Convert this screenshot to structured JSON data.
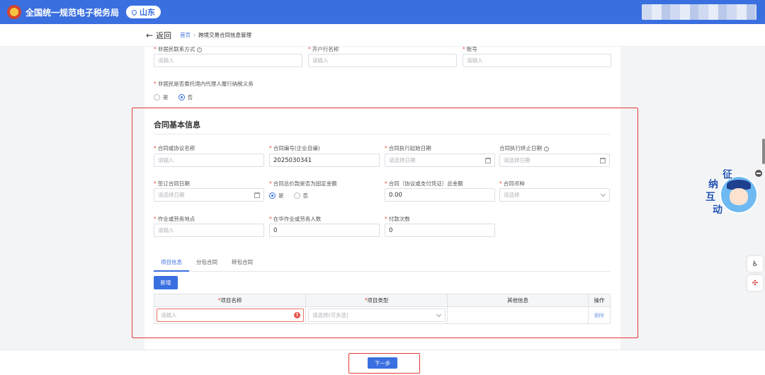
{
  "header": {
    "app_title": "全国统一规范电子税务局",
    "region": "山东"
  },
  "nav": {
    "back_label": "返回",
    "crumb_home": "首页",
    "crumb_sep": "›",
    "crumb_current": "跨境交易合同信息管理"
  },
  "top_fields": {
    "contact_label": "非居民联系方式",
    "bank_label": "开户行名称",
    "account_label": "账号",
    "placeholder": "请输入",
    "agent_question": "非居民是否委托境内代理人履行纳税义务",
    "yes": "是",
    "no": "否"
  },
  "contract": {
    "section_title": "合同基本信息",
    "name_label": "合同或协议名称",
    "name_placeholder": "请输入",
    "number_label": "合同编号(企业自编)",
    "number_value": "2025030341",
    "start_label": "合同执行起始日期",
    "end_label": "合同执行终止日期",
    "date_placeholder": "请选择日期",
    "sign_label": "签订合同日期",
    "fixed_label": "合同总价款是否为固定金额",
    "yes": "是",
    "no": "否",
    "total_label": "合同（协议或支付凭证）总金额",
    "total_value": "0.00",
    "currency_label": "合同币种",
    "select_placeholder": "请选择",
    "location_label": "作业或劳务地点",
    "location_placeholder": "请输入",
    "workers_label": "在华作业或劳务人数",
    "workers_value": "0",
    "payments_label": "付款次数",
    "payments_value": "0"
  },
  "tabs": [
    "项目信息",
    "分包合同",
    "转包合同"
  ],
  "table": {
    "add_button": "新增",
    "col_name": "项目名称",
    "col_type": "项目类型",
    "col_other": "其他信息",
    "col_action": "操作",
    "req_mark": "*",
    "name_placeholder": "请输入",
    "type_placeholder": "请选择(可多选)",
    "delete": "删除"
  },
  "footer": {
    "next_button": "下一步"
  },
  "mascot": {
    "chars": [
      "征",
      "纳",
      "互",
      "动"
    ]
  },
  "colors": {
    "primary": "#3a6fe0",
    "highlight": "#e53935",
    "required": "#e74c3c"
  }
}
